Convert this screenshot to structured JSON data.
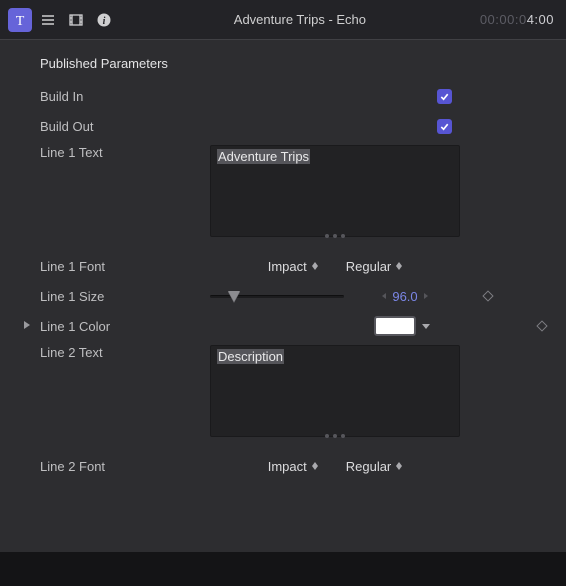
{
  "header": {
    "title": "Adventure Trips - Echo",
    "timecode_dim": "00:00:0",
    "timecode_light": "4:00"
  },
  "section_title": "Published Parameters",
  "rows": {
    "build_in": {
      "label": "Build In"
    },
    "build_out": {
      "label": "Build Out"
    },
    "line1_text": {
      "label": "Line 1 Text",
      "value": "Adventure Trips"
    },
    "line1_font": {
      "label": "Line 1 Font",
      "family": "Impact",
      "style": "Regular"
    },
    "line1_size": {
      "label": "Line 1 Size",
      "value": "96.0"
    },
    "line1_color": {
      "label": "Line 1 Color"
    },
    "line2_text": {
      "label": "Line 2 Text",
      "value": "Description"
    },
    "line2_font": {
      "label": "Line 2 Font",
      "family": "Impact",
      "style": "Regular"
    }
  },
  "colors": {
    "accent": "#5755d3",
    "value_text": "#7b86e6",
    "swatch": "#ffffff"
  }
}
